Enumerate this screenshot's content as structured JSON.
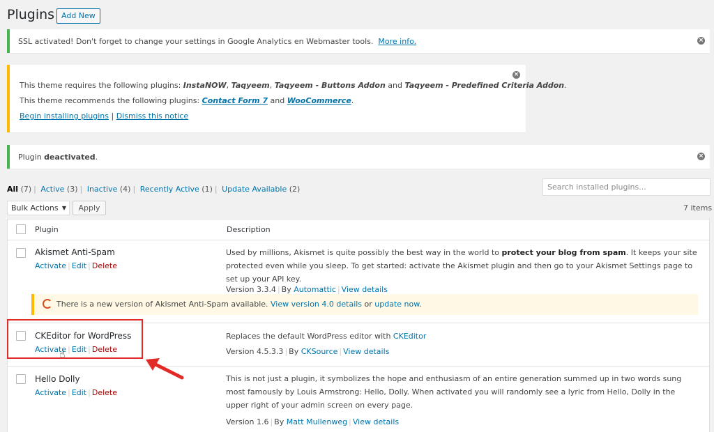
{
  "header": {
    "title": "Plugins",
    "add_new": "Add New"
  },
  "notices": {
    "ssl": {
      "text": "SSL activated!  Don't forget to change your settings in Google Analytics en Webmaster tools.",
      "link": "More info."
    },
    "theme": {
      "req_prefix": "This theme requires the following plugins: ",
      "req_plugins": [
        "InstaNOW",
        "Taqyeem",
        "Taqyeem - Buttons Addon",
        "Taqyeem - Predefined Criteria Addon"
      ],
      "req_and": " and ",
      "rec_prefix": "This theme recommends the following plugins: ",
      "rec_plugins": [
        "Contact Form 7",
        "WooCommerce"
      ],
      "begin": "Begin installing plugins",
      "dismiss": "Dismiss this notice"
    },
    "deactivated": {
      "prefix": "Plugin ",
      "bold": "deactivated",
      "suffix": "."
    }
  },
  "filters": [
    {
      "label": "All",
      "count": "(7)",
      "current": true
    },
    {
      "label": "Active",
      "count": "(3)"
    },
    {
      "label": "Inactive",
      "count": "(4)"
    },
    {
      "label": "Recently Active",
      "count": "(1)"
    },
    {
      "label": "Update Available",
      "count": "(2)"
    }
  ],
  "search": {
    "placeholder": "Search installed plugins..."
  },
  "bulk": {
    "label": "Bulk Actions",
    "apply": "Apply",
    "items": "7 items"
  },
  "table": {
    "col_plugin": "Plugin",
    "col_description": "Description",
    "actions": {
      "activate": "Activate",
      "edit": "Edit",
      "delete": "Delete"
    },
    "rows": [
      {
        "name": "Akismet Anti-Spam",
        "desc_pre": "Used by millions, Akismet is quite possibly the best way in the world to ",
        "desc_bold": "protect your blog from spam",
        "desc_post": ". It keeps your site protected even while you sleep. To get started: activate the Akismet plugin and then go to your Akismet Settings page to set up your API key.",
        "version": "Version 3.3.4",
        "by": "By",
        "author": "Automattic",
        "details": "View details",
        "update": {
          "text": "There is a new version of Akismet Anti-Spam available. ",
          "link1": "View version 4.0 details",
          "or": " or ",
          "link2": "update now",
          "end": "."
        }
      },
      {
        "name": "CKEditor for WordPress",
        "desc_pre": "Replaces the default WordPress editor with ",
        "desc_link": "CKEditor",
        "version": "Version 4.5.3.3",
        "by": "By",
        "author": "CKSource",
        "details": "View details"
      },
      {
        "name": "Hello Dolly",
        "desc": "This is not just a plugin, it symbolizes the hope and enthusiasm of an entire generation summed up in two words sung most famously by Louis Armstrong: Hello, Dolly. When activated you will randomly see a lyric from Hello, Dolly in the upper right of your admin screen on every page.",
        "version": "Version 1.6",
        "by": "By",
        "author": "Matt Mullenweg",
        "details": "View details"
      }
    ]
  },
  "colors": {
    "accent": "#0073aa",
    "delete": "#aa0000",
    "success": "#46b450",
    "warning": "#ffb900",
    "annotation": "#e02b27"
  }
}
